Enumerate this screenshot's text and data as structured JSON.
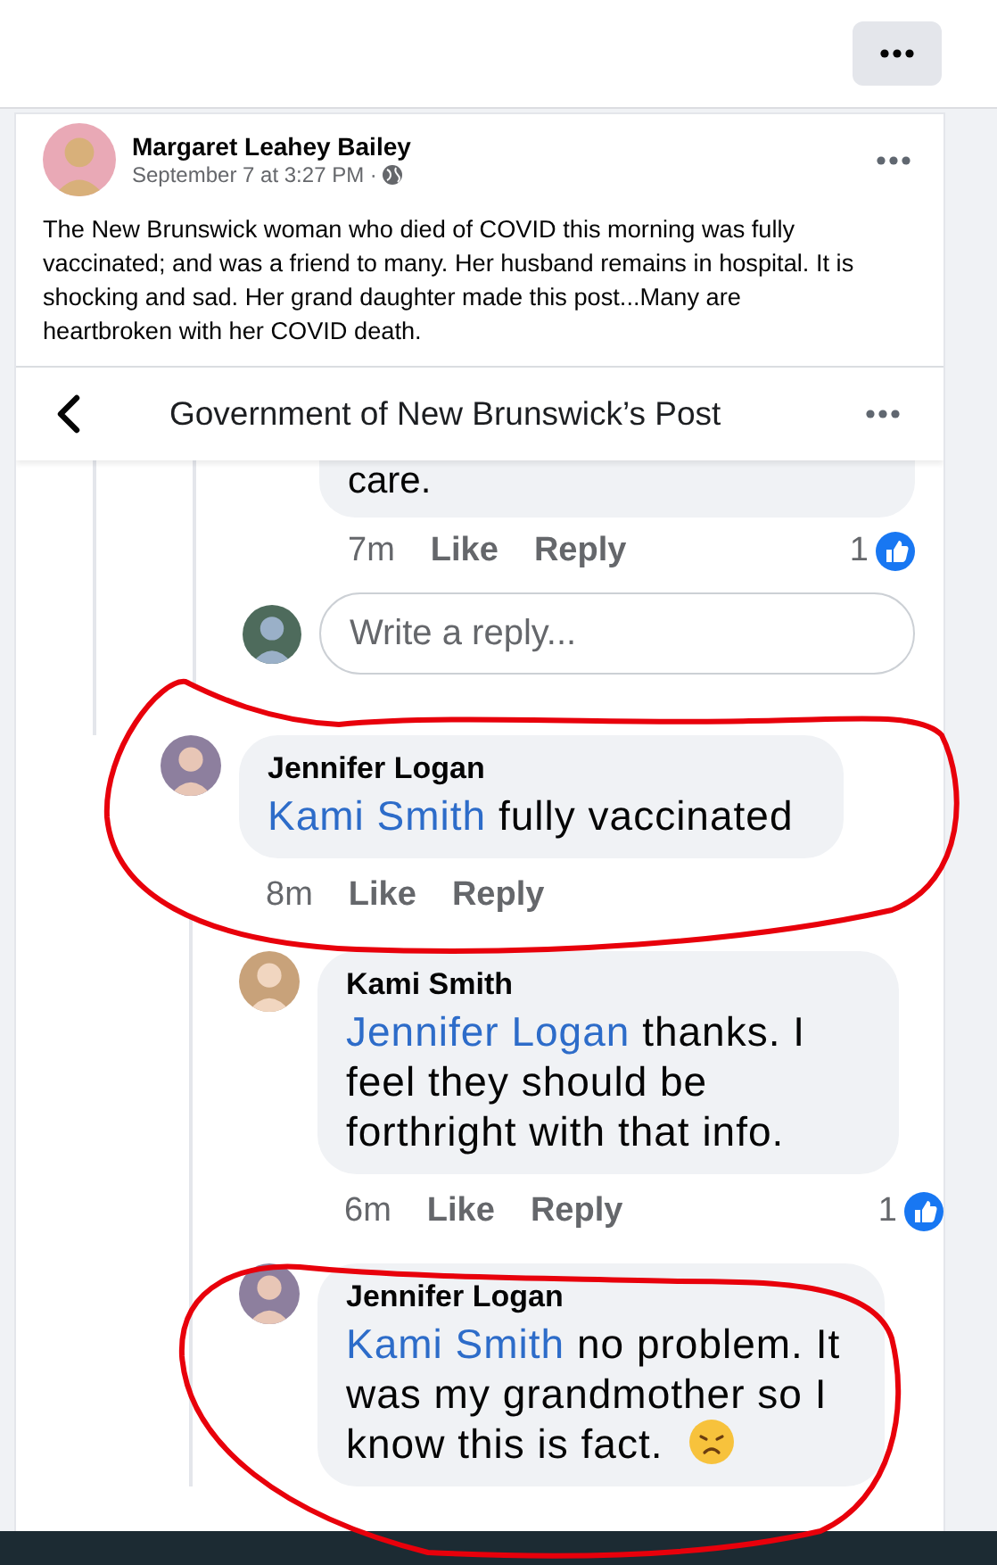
{
  "post": {
    "author": "Margaret Leahey Bailey",
    "timestamp": "September 7 at 3:27 PM ·",
    "text": "The New Brunswick woman who died of COVID this morning was fully vaccinated; and was a friend to many. Her husband remains in hospital. It is shocking and sad. Her grand daughter made this post...Many are heartbroken with her COVID death."
  },
  "shared_screenshot": {
    "title": "Government of New Brunswick’s Post",
    "earlier_reply": {
      "text": "care.",
      "time": "7m",
      "like": "Like",
      "reply": "Reply",
      "reactions": "1"
    },
    "reply_field": {
      "placeholder": "Write a reply..."
    },
    "comments": [
      {
        "author": "Jennifer Logan",
        "mention": "Kami Smith",
        "text": "fully vaccinated",
        "time": "8m",
        "like": "Like",
        "reply": "Reply",
        "children": [
          {
            "author": "Kami Smith",
            "mention": "Jennifer Logan",
            "text": "thanks. I feel they should be forthright with that info.",
            "time": "6m",
            "like": "Like",
            "reply": "Reply",
            "reactions": "1"
          },
          {
            "author": "Jennifer Logan",
            "mention": "Kami Smith",
            "text": "no problem. It was my grandmother so I know this is fact.",
            "has_emoji": true
          }
        ]
      }
    ]
  }
}
